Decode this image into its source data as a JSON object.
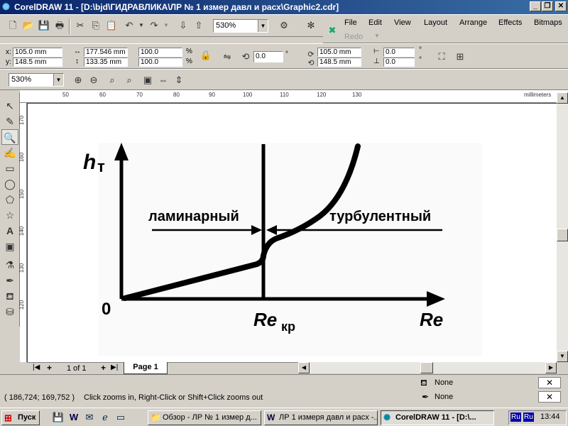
{
  "window": {
    "title": "CorelDRAW 11 - [D:\\bjd\\ГИДРАВЛИКА\\ЛР № 1 измер давл и расх\\Graphic2.cdr]"
  },
  "menu": {
    "items": [
      "File",
      "Edit",
      "View",
      "Layout",
      "Arrange",
      "Effects",
      "Bitmaps"
    ],
    "redo": "Redo"
  },
  "toolbar": {
    "zoom": "530%"
  },
  "property_bar": {
    "x": "105.0 mm",
    "y": "148.5 mm",
    "width": "177.546 mm",
    "height": "133.35 mm",
    "scale_w": "100.0",
    "scale_h": "100.0",
    "percent": "%",
    "rotation": "0.0",
    "rotation_unit": "°",
    "center_x": "105.0 mm",
    "center_y": "148.5 mm",
    "skew_h": "0.0",
    "skew_v": "0.0",
    "skew_unit": "°",
    "x_label": "x:",
    "y_label": "y:"
  },
  "zoom_bar": {
    "zoom": "530%"
  },
  "ruler": {
    "h_ticks": [
      "50",
      "60",
      "70",
      "80",
      "90",
      "100",
      "110",
      "120",
      "130"
    ],
    "v_ticks": [
      "170",
      "160",
      "150",
      "140",
      "130",
      "120"
    ],
    "unit": "millimeters"
  },
  "drawing": {
    "y_axis_label": "h",
    "y_axis_sub": "т",
    "origin": "0",
    "x_axis_label": "Re",
    "critical_label": "Re",
    "critical_sub": "кр",
    "left_region": "ламинарный",
    "right_region": "турбулентный"
  },
  "page_nav": {
    "counter": "1 of 1",
    "tab": "Page 1"
  },
  "status": {
    "coords": "( 186,724; 169,752 )",
    "hint": "Click zooms in, Right-Click or Shift+Click zooms out",
    "fill": "None",
    "outline": "None"
  },
  "taskbar": {
    "start": "Пуск",
    "tasks": [
      "Обзор - ЛР № 1 измер д...",
      "ЛР 1 измеря давл и расх -...",
      "CorelDRAW 11 - [D:\\..."
    ],
    "lang": "Ru",
    "lang2": "Ru",
    "time": "13:44"
  }
}
